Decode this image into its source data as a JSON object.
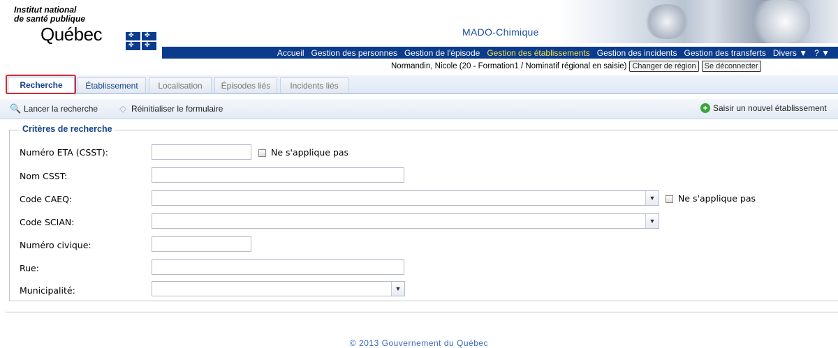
{
  "header": {
    "logo_line1": "Institut national",
    "logo_line2": "de santé publique",
    "logo_line3": "Québec",
    "app_title": "MADO-Chimique",
    "nav": [
      "Accueil",
      "Gestion des personnes",
      "Gestion de l'épisode",
      "Gestion des établissements",
      "Gestion des incidents",
      "Gestion des transferts",
      "Divers ▼",
      "? ▼"
    ],
    "nav_active": "Gestion des établissements",
    "user": "Normandin, Nicole (20 - Formation1 / Nominatif régional en saisie)",
    "change_region": "Changer de région",
    "logout": "Se déconnecter"
  },
  "tabs": [
    "Recherche",
    "Établissement",
    "Localisation",
    "Épisodes liés",
    "Incidents liés"
  ],
  "toolbar": {
    "search": "Lancer la recherche",
    "reset": "Réinitialiser le formulaire",
    "new": "Saisir un nouvel établissement"
  },
  "form": {
    "legend": "Critères de recherche",
    "eta_label": "Numéro ETA (CSST):",
    "eta_value": "",
    "na_label": "Ne s'applique pas",
    "nom_label": "Nom CSST:",
    "nom_value": "",
    "caeq_label": "Code CAEQ:",
    "caeq_value": "",
    "scian_label": "Code SCIAN:",
    "scian_value": "",
    "civique_label": "Numéro civique:",
    "civique_value": "",
    "rue_label": "Rue:",
    "rue_value": "",
    "muni_label": "Municipalité:",
    "muni_value": ""
  },
  "footer": "© 2013 Gouvernement du Québec",
  "colors": {
    "nav_bg": "#0a3b8c",
    "nav_active": "#f6e24a",
    "tab_active": "#15428b",
    "highlight": "#e0262a"
  },
  "icons": [
    "search-icon",
    "eraser-icon",
    "add-icon",
    "chevron-down-icon"
  ]
}
